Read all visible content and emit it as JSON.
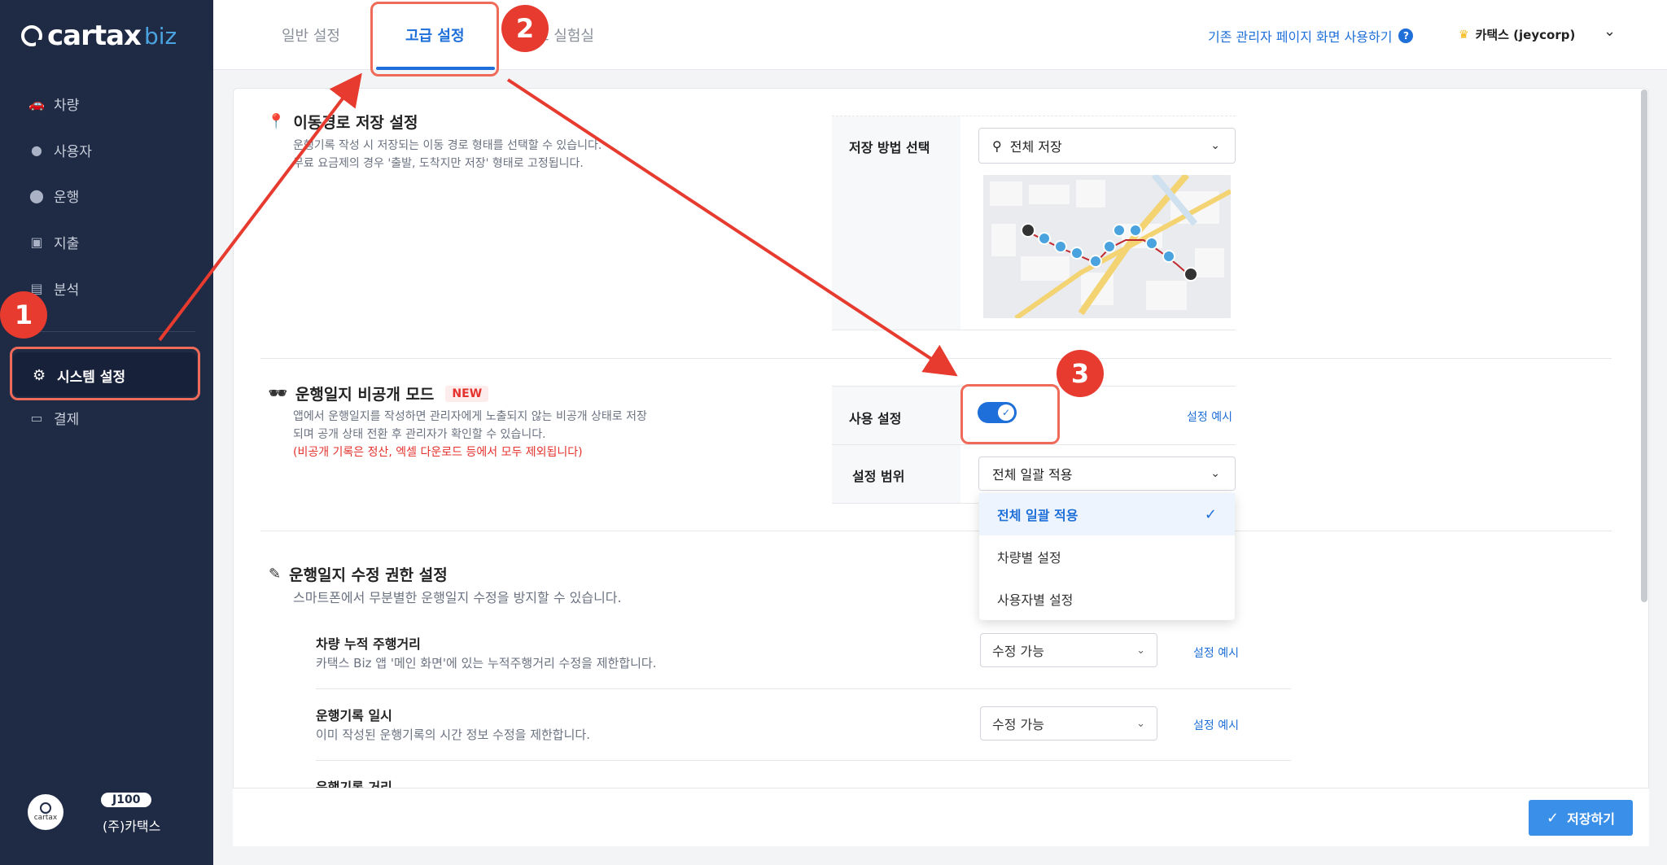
{
  "sidebar": {
    "logo_brand": "cartax",
    "logo_suffix": "biz",
    "items": [
      {
        "label": "차량",
        "icon": "car-icon"
      },
      {
        "label": "사용자",
        "icon": "person-icon"
      },
      {
        "label": "운행",
        "icon": "location-pin-icon"
      },
      {
        "label": "지출",
        "icon": "receipt-icon"
      },
      {
        "label": "분석",
        "icon": "chart-icon"
      },
      {
        "label": "시스템 설정",
        "icon": "gear-icon",
        "active": true
      },
      {
        "label": "결제",
        "icon": "card-icon"
      }
    ],
    "user": {
      "plan": "J100",
      "company": "(주)카택스",
      "avatar_text": "cartax"
    }
  },
  "topbar": {
    "tabs": [
      {
        "label": "일반 설정"
      },
      {
        "label": "고급 설정",
        "active": true
      },
      {
        "label": "스 실험실"
      }
    ],
    "legacy_link": "기존 관리자 페이지 화면 사용하기",
    "account": "카택스 (jeycorp)"
  },
  "route_section": {
    "title": "이동경로 저장 설정",
    "desc_line1": "운행기록 작성 시 저장되는 이동 경로 형태를 선택할 수 있습니다.",
    "desc_line2": "무료 요금제의 경우 '출발, 도착지만 저장' 형태로 고정됩니다.",
    "field_label": "저장 방법 선택",
    "selected": "전체 저장"
  },
  "private_section": {
    "title": "운행일지 비공개 모드",
    "badge": "NEW",
    "desc_line1": "앱에서 운행일지를 작성하면 관리자에게 노출되지 않는 비공개 상태로 저장",
    "desc_line2": "되며 공개 상태 전환 후 관리자가 확인할 수 있습니다.",
    "desc_warn": "(비공개 기록은 정산, 엑셀 다운로드 등에서 모두 제외됩니다)",
    "use_label": "사용 설정",
    "toggle_on": true,
    "example_link": "설정 예시",
    "scope_label": "설정 범위",
    "scope_selected": "전체 일괄 적용",
    "scope_options": [
      "전체 일괄 적용",
      "차량별 설정",
      "사용자별 설정"
    ]
  },
  "edit_section": {
    "title": "운행일지 수정 권한 설정",
    "desc": "스마트폰에서 무분별한 운행일지 수정을 방지할 수 있습니다.",
    "rows": [
      {
        "title": "차량 누적 주행거리",
        "desc": "카택스 Biz 앱 '메인 화면'에 있는 누적주행거리 수정을 제한합니다.",
        "value": "수정 가능",
        "link": "설정 예시"
      },
      {
        "title": "운행기록 일시",
        "desc": "이미 작성된 운행기록의 시간 정보 수정을 제한합니다.",
        "value": "수정 가능",
        "link": "설정 예시"
      },
      {
        "title": "운행기록 거리",
        "desc": "",
        "value": "",
        "link": ""
      }
    ]
  },
  "footer": {
    "save_label": "저장하기"
  },
  "annotations": {
    "n1": "1",
    "n2": "2",
    "n3": "3"
  },
  "colors": {
    "sidebar_bg": "#1f2a44",
    "accent": "#1e6fd9",
    "annotation": "#e63b2e",
    "warn": "#e5322d"
  }
}
